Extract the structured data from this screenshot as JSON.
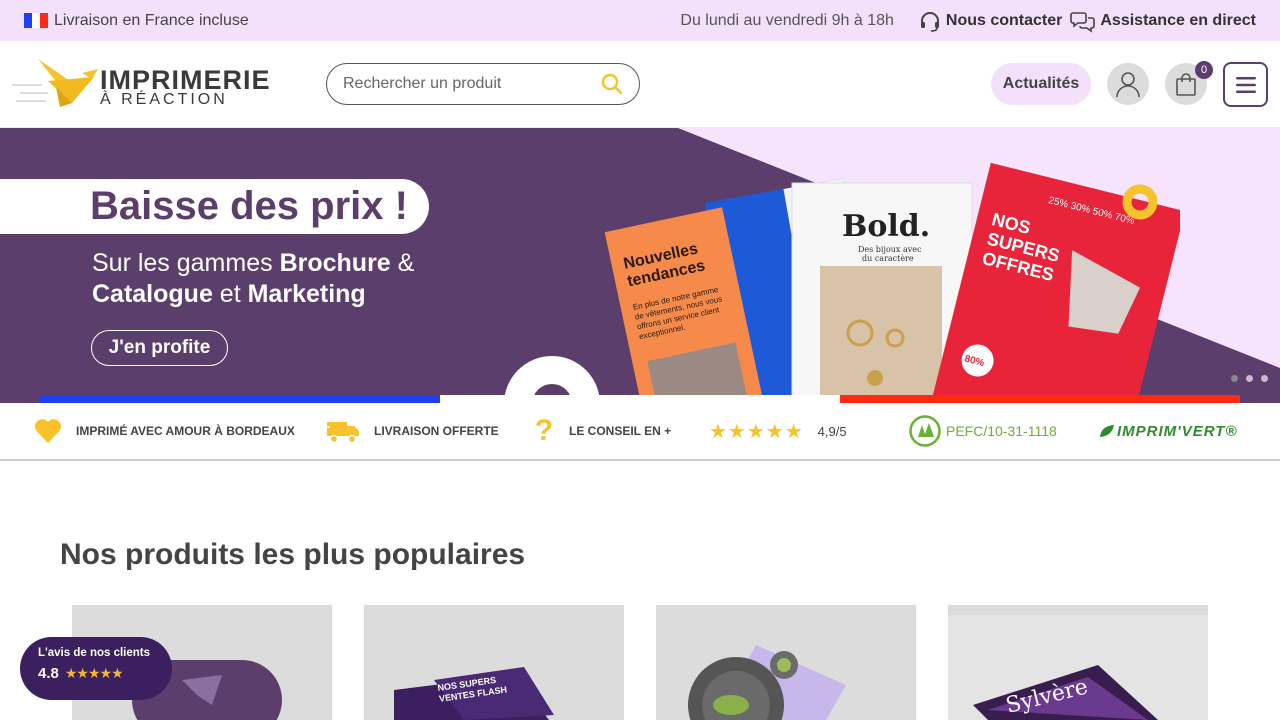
{
  "topbar": {
    "shipping": "Livraison en France incluse",
    "hours": "Du lundi au vendredi 9h à 18h",
    "contact": "Nous contacter",
    "live_help": "Assistance en direct"
  },
  "header": {
    "logo_line1": "IMPRIMERIE",
    "logo_line2": "À RÉACTION",
    "search_placeholder": "Rechercher un produit",
    "news_label": "Actualités",
    "cart_count": "0"
  },
  "hero": {
    "title": "Baisse des prix !",
    "sub_pre": "Sur les gammes ",
    "sub_b1": "Brochure",
    "sub_mid1": " & ",
    "sub_b2": "Catalogue",
    "sub_mid2": " et ",
    "sub_b3": "Marketing",
    "cta": "J'en profite",
    "mag1_title": "Nouvelles tendances",
    "mag1_text": "En plus de notre gamme de vêtements, nous vous offrons un service client exceptionnel.",
    "mag2_title": "Bold.",
    "mag2_sub": "Des bijoux avec du caractère",
    "mag3_title": "NOS SUPERS OFFRES",
    "mag3_badge": "80%",
    "mag3_pcts": [
      "25%",
      "30%",
      "50%",
      "70%"
    ]
  },
  "features": {
    "love": "IMPRIMÉ AVEC AMOUR À BORDEAUX",
    "delivery": "LIVRAISON OFFERTE",
    "advice": "LE CONSEIL EN +",
    "rating": "4,9/5",
    "pefc": "PEFC/10-31-1118",
    "imprimvert": "IMPRIM'VERT®"
  },
  "section": {
    "title": "Nos produits les plus populaires",
    "card2_text": "NOS SUPERS VENTES FLASH",
    "card4_text": "Sylvère"
  },
  "reviews": {
    "title": "L'avis de nos clients",
    "score": "4.8",
    "stars": "★★★★★"
  },
  "colors": {
    "brand_purple": "#5b3e6b",
    "pink_light": "#f3e1fb",
    "accent_yellow": "#f7c22b",
    "pefc_green": "#6cae37",
    "flag_blue": "#1f3ff0",
    "flag_red": "#ff2a12"
  }
}
